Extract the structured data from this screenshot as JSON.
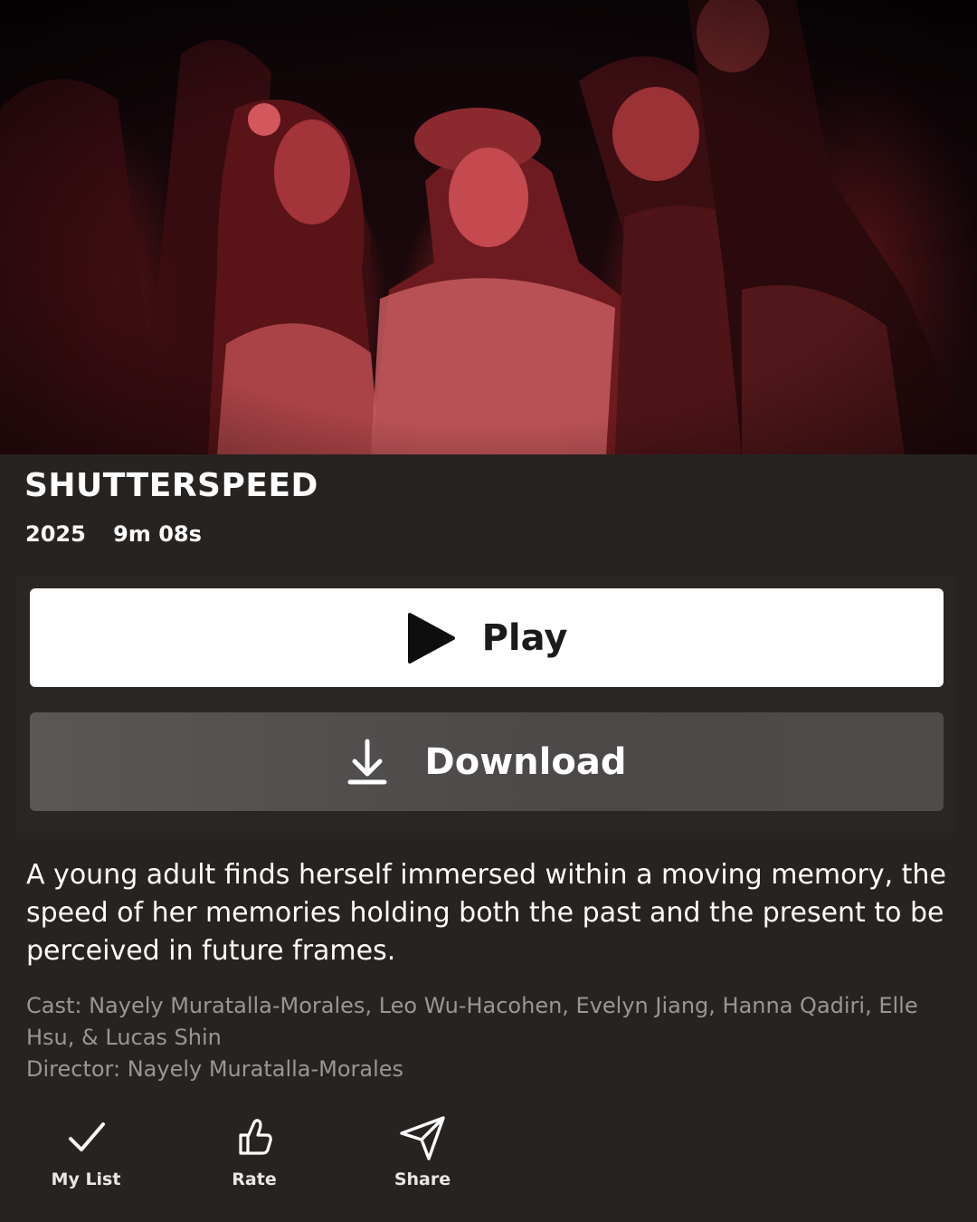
{
  "hero": {
    "image_icon": "film-still-image"
  },
  "title": "SHUTTERSPEED",
  "meta": {
    "year": "2025",
    "duration": "9m 08s"
  },
  "buttons": {
    "play_label": "Play",
    "download_label": "Download"
  },
  "description": "A young adult finds herself immersed within a moving memory, the speed of her memories holding both the past and the present to be perceived in future frames.",
  "credits": {
    "cast": "Cast: Nayely Muratalla-Morales, Leo Wu-Hacohen, Evelyn Jiang, Hanna Qadiri, Elle Hsu, & Lucas Shin",
    "director": "Director:  Nayely Muratalla-Morales"
  },
  "actions": [
    {
      "label": "My List",
      "icon": "checkmark-icon"
    },
    {
      "label": "Rate",
      "icon": "thumbs-up-icon"
    },
    {
      "label": "Share",
      "icon": "send-icon"
    }
  ],
  "colors": {
    "background": "#272321",
    "play_button": "#ffffff",
    "download_button": "#545150",
    "credits_text": "#9a9696"
  }
}
